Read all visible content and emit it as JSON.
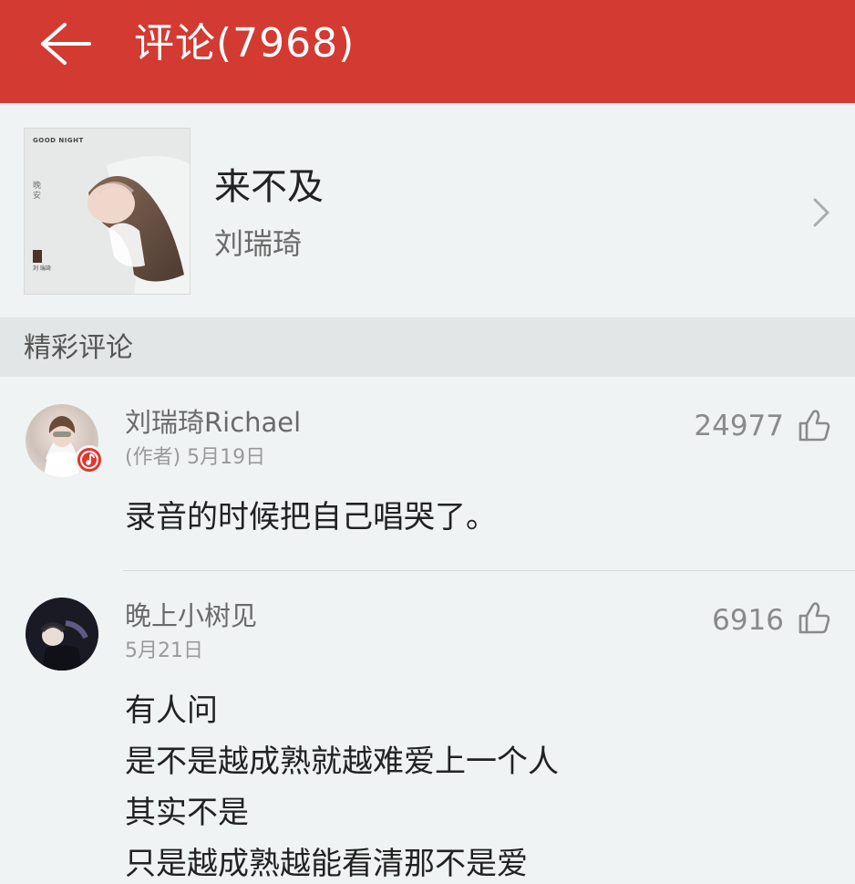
{
  "header": {
    "title": "评论(7968)"
  },
  "song": {
    "name": "来不及",
    "artist": "刘瑞琦",
    "cover": {
      "top_text": "GOOD NIGHT",
      "side_text": "晚安",
      "small_text": "刘\n瑞琦"
    }
  },
  "section": {
    "title": "精彩评论"
  },
  "comments": [
    {
      "username": "刘瑞琦Richael",
      "meta": "(作者) 5月19日",
      "likes": "24977",
      "text": "录音的时候把自己唱哭了。"
    },
    {
      "username": "晚上小树见",
      "meta": "5月21日",
      "likes": "6916",
      "text": "有人问\n是不是越成熟就越难爱上一个人\n其实不是\n只是越成熟越能看清那不是爱"
    }
  ],
  "icons": {
    "back": "back-arrow-icon",
    "chevron": "chevron-right-icon",
    "like": "thumbs-up-icon",
    "music_badge": "music-note-icon"
  },
  "colors": {
    "brand_red": "#d33a31",
    "badge_red": "#e2362d",
    "background": "#eff3f3"
  }
}
